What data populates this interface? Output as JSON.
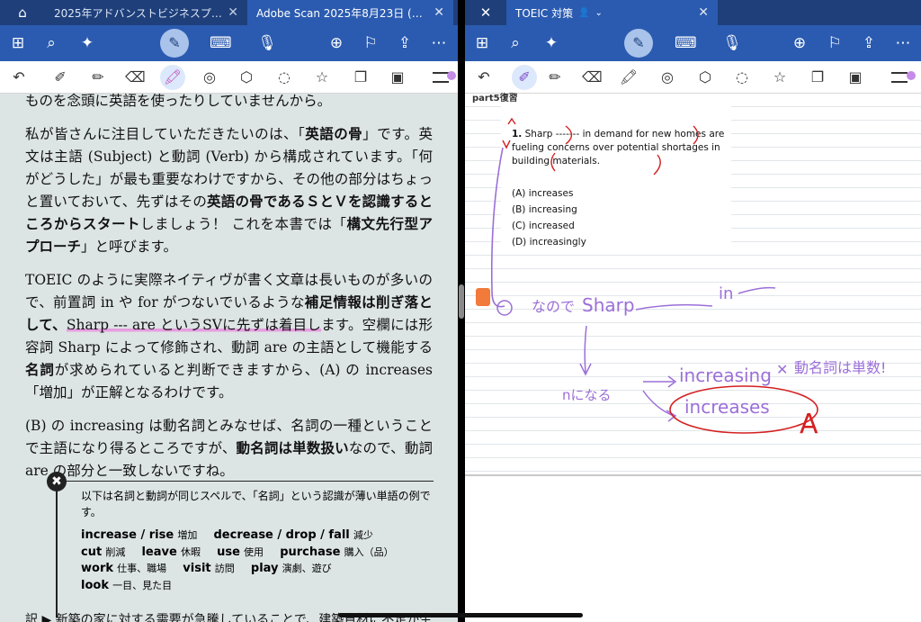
{
  "left": {
    "tabs": [
      {
        "label": "2025年アドバンストビジネスプ…",
        "active": false
      },
      {
        "label": "Adobe Scan 2025年8月23日 (…",
        "active": true
      }
    ],
    "paragraphs": {
      "p0": "ものを念頭に英語を使ったりしていませんから。",
      "p1a": "私が皆さんに注目していただきたいのは、「",
      "p1b": "英語の骨",
      "p1c": "」です。英文は主語 (Subject) と動詞 (Verb) から構成されています。「何がどうした」が最も重要なわけですから、その他の部分はちょっと置いておいて、先ずはその",
      "p1d": "英語の骨であるＳとＶを認識するところからスタート",
      "p1e": "しましょう！ これを本書では「",
      "p1f": "構文先行型アプローチ",
      "p1g": "」と呼びます。",
      "p2a": "TOEIC のように実際ネイティヴが書く文章は長いものが多いので、前置詞 in や for がつないでいるような",
      "p2b": "補足情報は削ぎ落として、",
      "p2c": "Sharp --- are というSVに先ずは着目し",
      "p2d": "ます。空欄には形容詞 Sharp によって修飾され、動詞 are の主語として機能する",
      "p2e": "名詞",
      "p2f": "が求められていると判断できますから、(A) の increases「増加」が正解となるわけです。",
      "p3a": "(B) の increasing は動名詞とみなせば、名詞の一種ということで主語になり得るところですが、",
      "p3b": "動名詞は単数扱い",
      "p3c": "なので、動詞 are の部分と一致しないですね。"
    },
    "note_intro": "以下は名詞と動詞が同じスペルで、「名詞」という認識が薄い単語の例です。",
    "vocab": [
      [
        {
          "w": "increase / rise",
          "m": "増加"
        },
        {
          "w": "decrease / drop / fall",
          "m": "減少"
        }
      ],
      [
        {
          "w": "cut",
          "m": "削減"
        },
        {
          "w": "leave",
          "m": "休暇"
        },
        {
          "w": "use",
          "m": "使用"
        },
        {
          "w": "purchase",
          "m": "購入（品）"
        }
      ],
      [
        {
          "w": "work",
          "m": "仕事、職場"
        },
        {
          "w": "visit",
          "m": "訪問"
        },
        {
          "w": "play",
          "m": "演劇、遊び"
        }
      ],
      [
        {
          "w": "look",
          "m": "一目、見た目"
        }
      ]
    ],
    "bottom_text": "訳 ▶ 新築の家に対する需要が急騰していることで、建築資材に不足が生"
  },
  "right": {
    "tab": {
      "label": "TOEIC 対策",
      "active": true
    },
    "part_header": "part5復習",
    "question": {
      "number": "1.",
      "text": "Sharp ------- in demand for new homes are fueling concerns over potential shortages in building materials.",
      "options": [
        "(A) increases",
        "(B) increasing",
        "(C) increased",
        "(D) increasingly"
      ]
    },
    "handwriting": {
      "line1_a": "なので",
      "line1_b": "Sharp",
      "line1_c": "in",
      "line2_a": "nになる",
      "line2_b": "increasing",
      "line2_c": "✕",
      "line2_d": "動名詞は単数!",
      "line3": "increases",
      "answer": "A"
    }
  },
  "colors": {
    "ink_purple": "#9b6fd8",
    "ink_red": "#d42020",
    "header_blue": "#2b5bb0",
    "tab_dark": "#1e3f7a"
  }
}
